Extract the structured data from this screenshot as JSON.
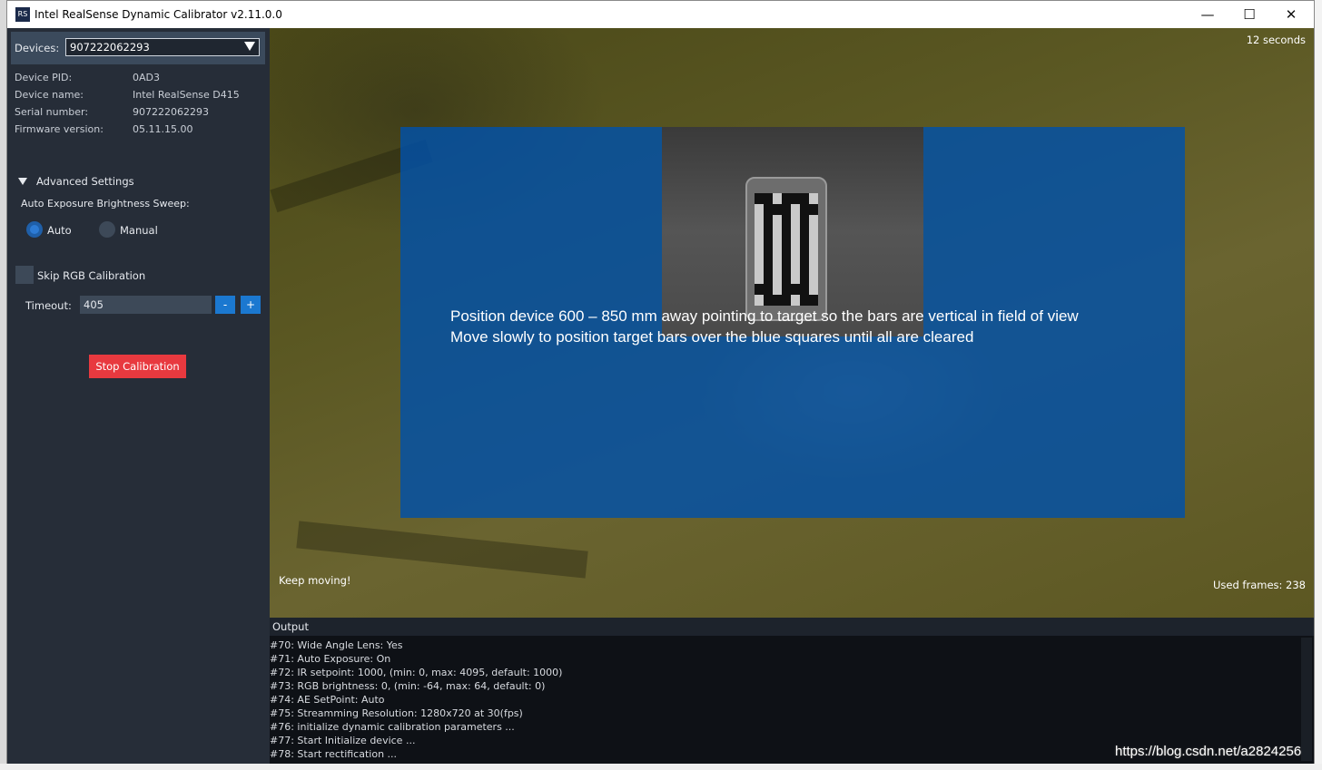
{
  "window": {
    "title": "Intel RealSense Dynamic Calibrator v2.11.0.0",
    "icon_text": "RS",
    "minimize_glyph": "—",
    "maximize_glyph": "☐",
    "close_glyph": "✕"
  },
  "sidebar": {
    "devices_label": "Devices:",
    "device_selected": "907222062293",
    "info": [
      {
        "label": "Device PID:",
        "value": "0AD3"
      },
      {
        "label": "Device name:",
        "value": "Intel RealSense D415"
      },
      {
        "label": "Serial number:",
        "value": "907222062293"
      },
      {
        "label": "Firmware version:",
        "value": "05.11.15.00"
      }
    ],
    "advanced_settings_label": "Advanced Settings",
    "sweep_label": "Auto Exposure Brightness Sweep:",
    "radio_options": [
      {
        "label": "Auto",
        "selected": true
      },
      {
        "label": "Manual",
        "selected": false
      }
    ],
    "skip_rgb_label": "Skip RGB Calibration",
    "skip_rgb_checked": false,
    "timeout_label": "Timeout:",
    "timeout_value": "405",
    "minus_label": "-",
    "plus_label": "+",
    "stop_label": "Stop Calibration"
  },
  "view": {
    "timer_text": "12 seconds",
    "instruction_line1": "Position device 600 – 850 mm away pointing to target so the bars are vertical in field of view",
    "instruction_line2": "Move slowly to position target bars over the blue squares until all are cleared",
    "status_text": "Keep moving!",
    "frames_text": "Used frames: 238"
  },
  "output": {
    "title": "Output",
    "lines": [
      "#70: Wide Angle Lens: Yes",
      "#71: Auto Exposure: On",
      "#72: IR setpoint: 1000, (min: 0, max: 4095, default: 1000)",
      "#73: RGB brightness: 0, (min: -64, max: 64, default: 0)",
      "#74: AE SetPoint: Auto",
      "#75: Streamming Resolution: 1280x720 at 30(fps)",
      "#76: initialize dynamic calibration parameters ...",
      "#77: Start Initialize device ...",
      "#78: Start rectification ..."
    ]
  },
  "watermark": "https://blog.csdn.net/a2824256",
  "colors": {
    "sidebar_bg": "#262d38",
    "accent_blue": "#1b78d0",
    "stop_red": "#e8393f",
    "overlay_blue": "#0050aa"
  }
}
